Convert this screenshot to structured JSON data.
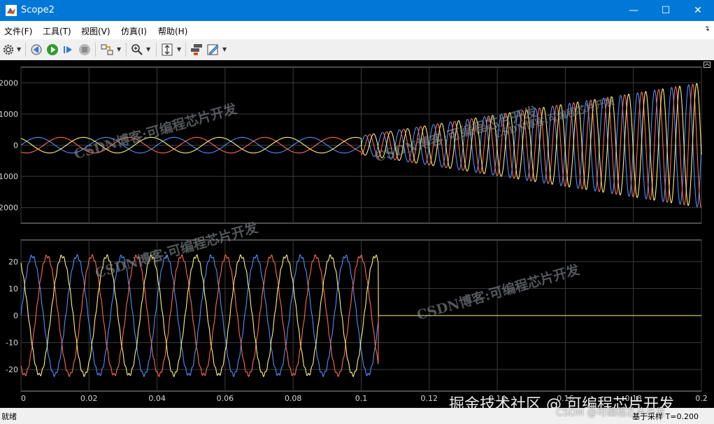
{
  "window": {
    "title": "Scope2",
    "minimize": "—",
    "maximize": "☐",
    "close": "✕"
  },
  "menu": {
    "items": [
      "文件(F)",
      "工具(T)",
      "视图(V)",
      "仿真(I)",
      "帮助(H)"
    ]
  },
  "toolbar": {
    "icons": [
      "gear-icon",
      "step-back-icon",
      "run-icon",
      "step-forward-icon",
      "stop-icon",
      "highlight-block-icon",
      "zoom-icon",
      "autoscale-icon",
      "layout-icon",
      "style-icon"
    ]
  },
  "axes": {
    "top": {
      "yticks": [
        "2000",
        "1000",
        "0",
        "-1000",
        "-2000"
      ]
    },
    "bottom": {
      "yticks": [
        "20",
        "10",
        "0",
        "-10",
        "-20"
      ]
    },
    "xticks": [
      "0",
      "0.02",
      "0.04",
      "0.06",
      "0.08",
      "0.1",
      "0.12",
      "0.14",
      "0.16",
      "0.18",
      "0.2"
    ]
  },
  "colors": {
    "phase_a": "#4d90fe",
    "phase_b": "#ff6a50",
    "phase_c": "#fff27a",
    "grid": "#3c3c3c",
    "background": "#000000"
  },
  "watermarks": {
    "diag1": "CSDN博客:可编程芯片开发",
    "diag2": "CSDN博客:可编程芯片开发",
    "diag3": "CSDN博客:可编程芯片开发",
    "diag4": "CSDN博客:可编程芯片开发",
    "diag5": "CSDN博客:可编程芯片开发",
    "corner_big": "掘金技术社区 @ 可编程芯片开发",
    "corner_small": "CSDN @可编程芯片开发"
  },
  "status": {
    "left": "就绪",
    "right": "基于采样 T=0.200"
  },
  "chart_data": [
    {
      "type": "line",
      "title": "",
      "x_range": [
        0,
        0.2
      ],
      "ylim": [
        -2500,
        2500
      ],
      "grid": true,
      "series": [
        {
          "color": "#4d90fe",
          "phase_deg": 0
        },
        {
          "color": "#ff6a50",
          "phase_deg": -120
        },
        {
          "color": "#fff27a",
          "phase_deg": 120
        }
      ],
      "segments": [
        {
          "t_end": 0.1,
          "amplitude": 250,
          "frequency_hz": 50
        },
        {
          "t_start": 0.1,
          "t_end": 0.2,
          "amplitude_start": 300,
          "amplitude_end": 2000,
          "frequency_hz": 200
        }
      ]
    },
    {
      "type": "line",
      "title": "",
      "x_range": [
        0,
        0.2
      ],
      "ylim": [
        -28,
        28
      ],
      "grid": true,
      "series": [
        {
          "color": "#4d90fe",
          "phase_deg": 0
        },
        {
          "color": "#ff6a50",
          "phase_deg": -120
        },
        {
          "color": "#fff27a",
          "phase_deg": 120
        }
      ],
      "segments": [
        {
          "t_end": 0.105,
          "amplitude": 22,
          "frequency_hz": 76
        },
        {
          "t_start": 0.105,
          "t_end": 0.2,
          "amplitude": 0
        }
      ]
    }
  ]
}
